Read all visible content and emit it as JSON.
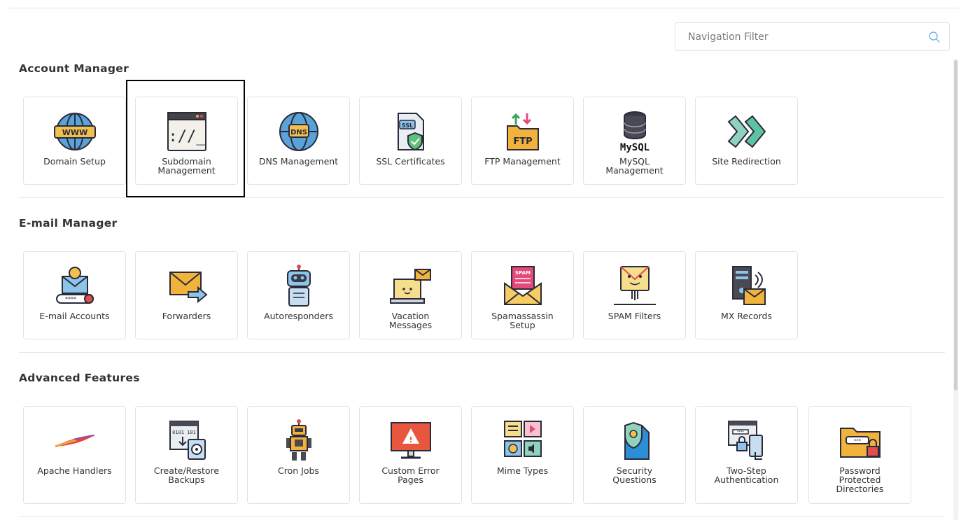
{
  "search": {
    "placeholder": "Navigation Filter",
    "icon": "search-icon"
  },
  "sections": [
    {
      "title": "Account Manager",
      "tiles": [
        {
          "label": "Domain Setup",
          "icon": "globe-www-icon"
        },
        {
          "label": "Subdomain\nManagement",
          "icon": "terminal-window-icon"
        },
        {
          "label": "DNS Management",
          "icon": "globe-dns-icon"
        },
        {
          "label": "SSL Certificates",
          "icon": "ssl-certificate-icon"
        },
        {
          "label": "FTP Management",
          "icon": "ftp-folder-icon"
        },
        {
          "label": "MySQL\nManagement",
          "icon": "mysql-database-icon"
        },
        {
          "label": "Site Redirection",
          "icon": "redirect-arrows-icon"
        }
      ]
    },
    {
      "title": "E-mail Manager",
      "tiles": [
        {
          "label": "E-mail Accounts",
          "icon": "email-account-icon"
        },
        {
          "label": "Forwarders",
          "icon": "email-forward-icon"
        },
        {
          "label": "Autoresponders",
          "icon": "robot-icon"
        },
        {
          "label": "Vacation\nMessages",
          "icon": "vacation-laptop-icon"
        },
        {
          "label": "Spamassassin\nSetup",
          "icon": "spam-envelope-icon"
        },
        {
          "label": "SPAM Filters",
          "icon": "spam-filter-icon"
        },
        {
          "label": "MX Records",
          "icon": "mx-server-icon"
        }
      ]
    },
    {
      "title": "Advanced Features",
      "tiles": [
        {
          "label": "Apache Handlers",
          "icon": "apache-feather-icon"
        },
        {
          "label": "Create/Restore\nBackups",
          "icon": "backup-icon"
        },
        {
          "label": "Cron Jobs",
          "icon": "cron-robot-icon"
        },
        {
          "label": "Custom Error\nPages",
          "icon": "error-monitor-icon"
        },
        {
          "label": "Mime Types",
          "icon": "media-types-icon"
        },
        {
          "label": "Security\nQuestions",
          "icon": "security-document-icon"
        },
        {
          "label": "Two-Step\nAuthentication",
          "icon": "two-step-auth-icon"
        },
        {
          "label": "Password\nProtected\nDirectories",
          "icon": "locked-folder-icon"
        }
      ]
    }
  ]
}
